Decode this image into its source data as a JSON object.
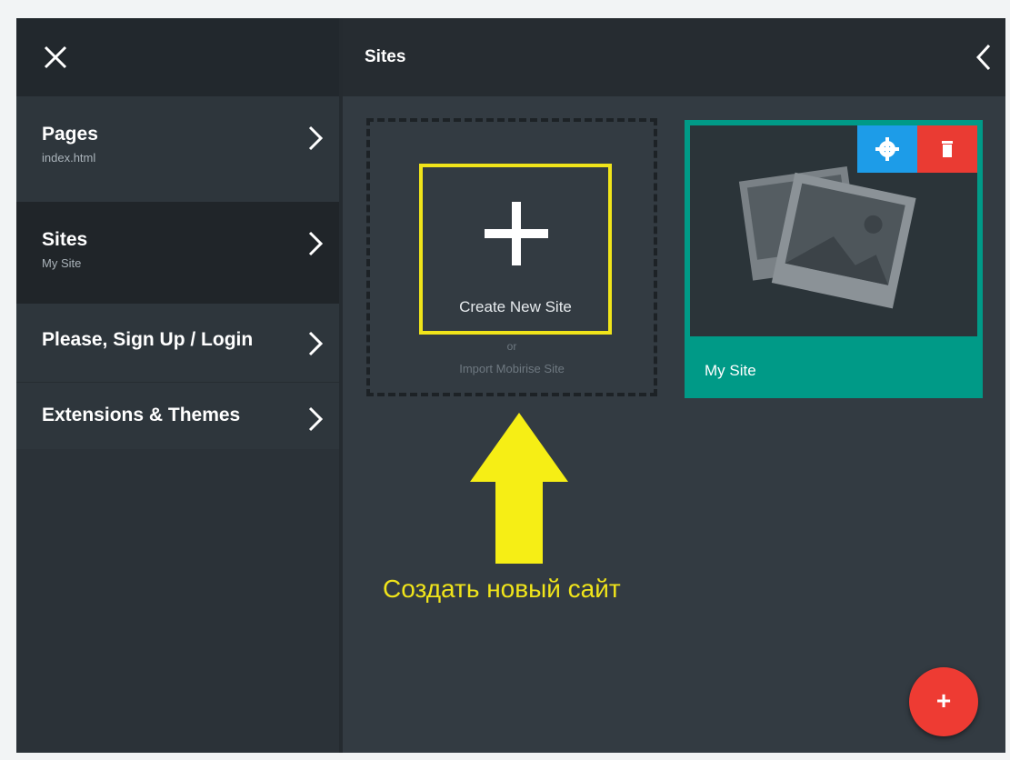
{
  "sidebar": {
    "close_icon": "close-icon",
    "items": [
      {
        "title": "Pages",
        "subtitle": "index.html"
      },
      {
        "title": "Sites",
        "subtitle": "My Site"
      },
      {
        "title": "Please, Sign Up / Login"
      },
      {
        "title": "Extensions & Themes"
      }
    ]
  },
  "header": {
    "title": "Sites",
    "back_icon": "chevron-left-icon"
  },
  "create_card": {
    "label": "Create New Site",
    "or_text": "or",
    "import_text": "Import Mobirise Site"
  },
  "site_card": {
    "name": "My Site",
    "settings_icon": "gear-icon",
    "delete_icon": "trash-icon"
  },
  "annotation": {
    "text": "Создать новый сайт",
    "color": "#f0e41a"
  },
  "fab": {
    "label": "+",
    "color": "#ee3b33"
  },
  "colors": {
    "accent_teal": "#009a87",
    "settings_blue": "#1d9ce8",
    "delete_red": "#ea3b33"
  }
}
